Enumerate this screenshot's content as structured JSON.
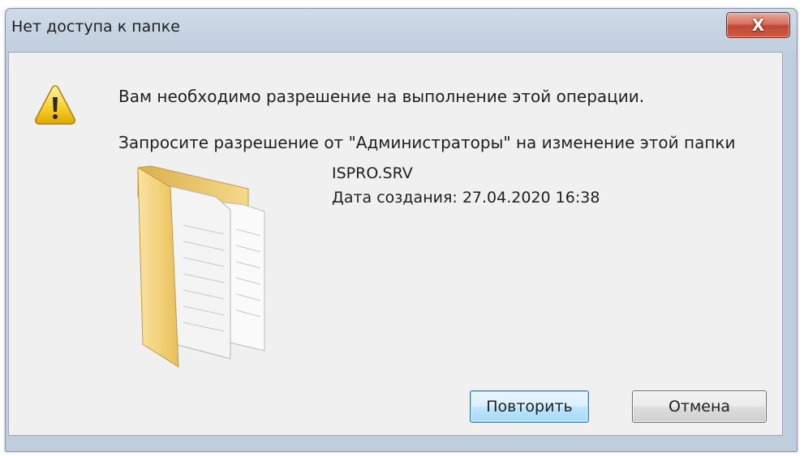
{
  "window": {
    "title": "Нет доступа к папке",
    "close_label": "X"
  },
  "dialog": {
    "icon": "warning-icon",
    "message_primary": "Вам необходимо разрешение на выполнение этой операции.",
    "message_secondary": "Запросите разрешение от \"Администраторы\" на изменение этой папки",
    "item": {
      "icon": "folder-icon",
      "name": "ISPRO.SRV",
      "created": "Дата создания: 27.04.2020 16:38"
    },
    "buttons": {
      "retry": "Повторить",
      "cancel": "Отмена"
    }
  },
  "colors": {
    "title_bar": "#c3d1e0",
    "client_bg": "#f0f0f0",
    "close_button": "#c24a33",
    "default_button_border": "#3c7fb1",
    "folder": "#f2d37c"
  }
}
